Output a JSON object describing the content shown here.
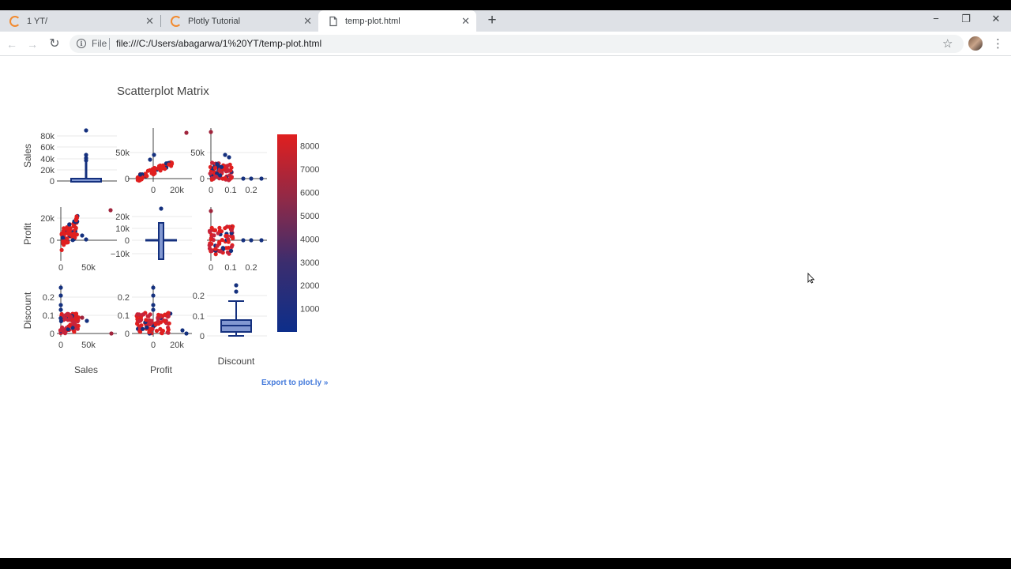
{
  "browser": {
    "tabs": [
      {
        "title": "1 YT/",
        "active": false,
        "icon": "loading-spinner-icon"
      },
      {
        "title": "Plotly Tutorial",
        "active": false,
        "icon": "loading-spinner-icon"
      },
      {
        "title": "temp-plot.html",
        "active": true,
        "icon": "document-icon"
      }
    ],
    "new_tab_glyph": "+",
    "window_controls": {
      "minimize": "−",
      "restore": "❐",
      "close": "✕"
    },
    "address": {
      "scheme_label": "File",
      "url": "file:///C:/Users/abagarwa/1%20YT/temp-plot.html"
    },
    "nav": {
      "back": "←",
      "forward": "→",
      "reload": "↻"
    },
    "star_glyph": "☆",
    "menu_glyph": "⋮",
    "info_glyph": "i"
  },
  "chart_data": {
    "type": "scatter",
    "title": "Scatterplot Matrix",
    "dimensions": [
      "Sales",
      "Profit",
      "Discount"
    ],
    "axis_ticks": {
      "Sales": {
        "x_labels": [
          "0",
          "50k"
        ],
        "y_labels": [
          "0",
          "20k",
          "40k",
          "60k",
          "80k"
        ]
      },
      "Profit": {
        "x_labels": [
          "0",
          "20k"
        ],
        "y_labels": [
          "0",
          "20k"
        ],
        "diag_y_labels": [
          "−10k",
          "0",
          "10k",
          "20k"
        ]
      },
      "Discount": {
        "x_labels": [
          "0",
          "0.1",
          "0.2"
        ],
        "y_labels": [
          "0",
          "0.1",
          "0.2"
        ]
      }
    },
    "panel_ticks": {
      "row0": {
        "col1_y": [
          "0",
          "50k"
        ],
        "col2_y": [
          "0",
          "50k"
        ]
      },
      "row1": {
        "col0_y": [
          "0",
          "20k"
        ]
      },
      "row2": {
        "col0_y": [
          "0",
          "0.1",
          "0.2"
        ],
        "col1_y": [
          "0",
          "0.1",
          "0.2"
        ]
      }
    },
    "colorbar": {
      "ticks": [
        "1000",
        "2000",
        "3000",
        "4000",
        "5000",
        "6000",
        "7000",
        "8000"
      ],
      "range": [
        0,
        8500
      ],
      "low_color": "#0d2e8a",
      "high_color": "#e01f1f"
    },
    "diagonal": {
      "Sales": "box",
      "Profit": "box",
      "Discount": "box"
    },
    "colors": {
      "high": "#e01f1f",
      "low": "#14307e",
      "box_fill": "#8298d1",
      "box_line": "#14307e"
    }
  },
  "export_link": "Export to plot.ly »"
}
